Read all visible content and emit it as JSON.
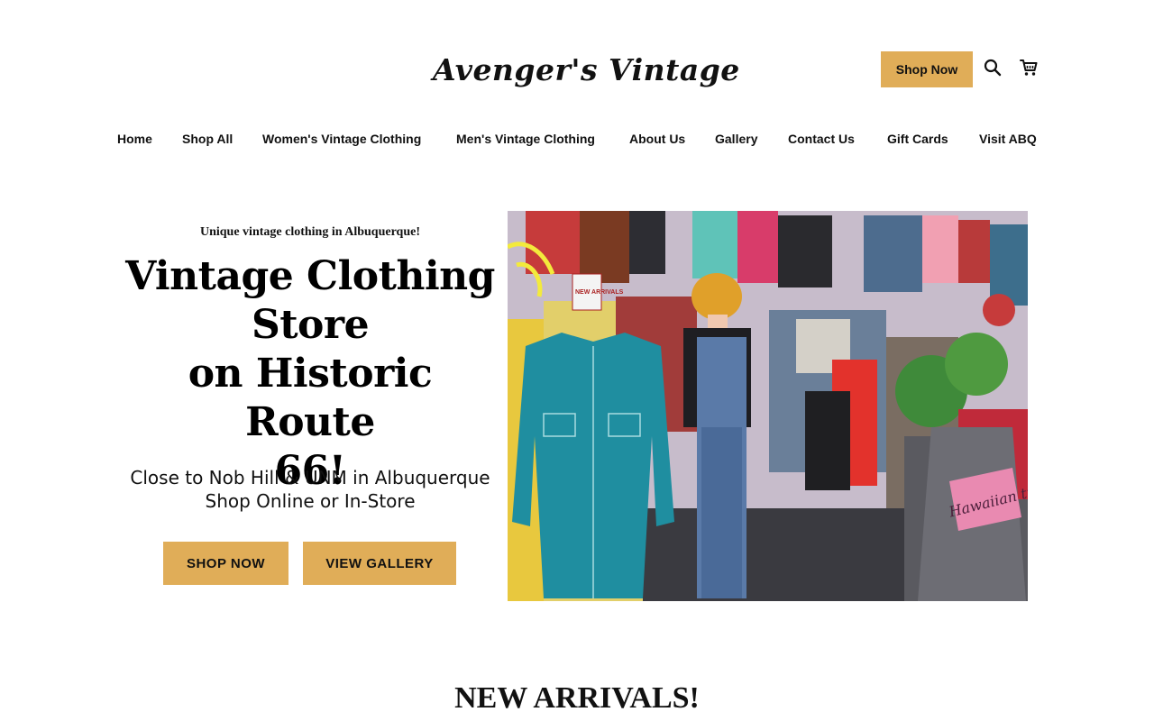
{
  "header": {
    "logo_text": "Avenger's Vintage",
    "shop_now_label": "Shop Now"
  },
  "nav": {
    "items": [
      {
        "label": "Home"
      },
      {
        "label": "Shop All"
      },
      {
        "label": "Women's Vintage Clothing"
      },
      {
        "label": "Men's Vintage Clothing"
      },
      {
        "label": "About Us"
      },
      {
        "label": "Gallery"
      },
      {
        "label": "Contact Us"
      },
      {
        "label": "Gift Cards"
      },
      {
        "label": "Visit ABQ"
      }
    ]
  },
  "hero": {
    "tagline": "Unique vintage clothing in Albuquerque!",
    "title_line1": "Vintage Clothing",
    "title_line2": "Store",
    "title_line3": "on Historic Route",
    "title_line4": "66!",
    "sub_line1": "Close to Nob Hill & UNM in Albuquerque",
    "sub_line2": "Shop Online or In-Store",
    "shop_button": "SHOP NOW",
    "gallery_button": "VIEW GALLERY"
  },
  "image_labels": {
    "shirt_text": "Hawaiian tropic",
    "sign_text": "NEW ARRIVALS"
  },
  "section": {
    "new_arrivals": "NEW ARRIVALS!"
  },
  "colors": {
    "accent": "#e0ad58",
    "text": "#111111",
    "background": "#ffffff"
  },
  "icons": {
    "search": "search-icon",
    "cart": "cart-icon",
    "logo": "lion-icon"
  }
}
